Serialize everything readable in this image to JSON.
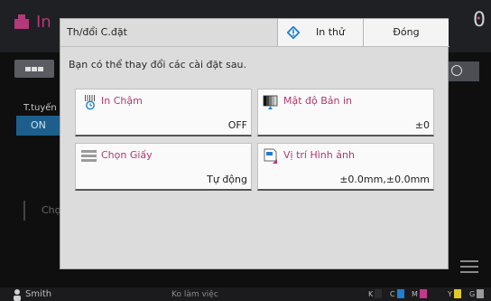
{
  "background": {
    "app_title": "In",
    "counter": "0",
    "side_label": "T.tuyến",
    "side_toggle": "ON",
    "faded_item": "Chọ",
    "user": "Smith",
    "status": "Ko làm việc",
    "ink_levels": [
      {
        "label": "K",
        "color": "#2b2b2b"
      },
      {
        "label": "C",
        "color": "#1f7fd0"
      },
      {
        "label": "M",
        "color": "#c5378c"
      },
      {
        "label": "Y",
        "color": "#e2c827"
      },
      {
        "label": "G",
        "color": "#9a9a9a"
      }
    ]
  },
  "dialog": {
    "title": "Th/đổi C.đặt",
    "test_print_label": "In thử",
    "close_label": "Đóng",
    "message": "Bạn có thể thay đổi các cài đặt sau.",
    "settings": [
      {
        "name": "In Chậm",
        "value": "OFF",
        "icon": "slow-print-icon"
      },
      {
        "name": "Mật độ Bản in",
        "value": "±0",
        "icon": "print-density-icon"
      },
      {
        "name": "Chọn Giấy",
        "value": "Tự động",
        "icon": "paper-tray-icon"
      },
      {
        "name": "Vị trí Hình ảnh",
        "value": "±0.0mm,±0.0mm",
        "icon": "image-position-icon"
      }
    ]
  },
  "colors": {
    "accent_pink": "#b0386f",
    "accent_blue": "#1a7fd1"
  }
}
